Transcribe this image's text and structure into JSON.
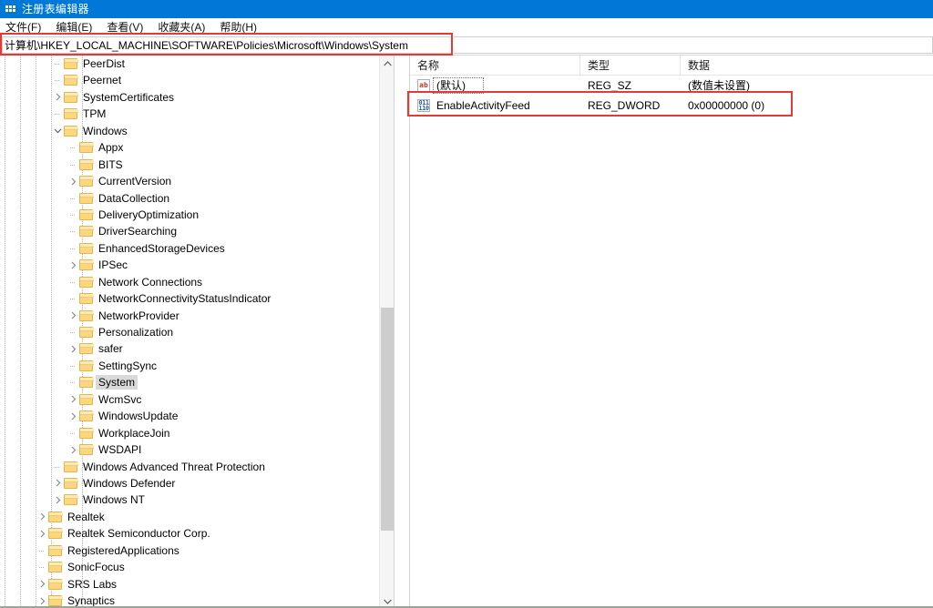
{
  "window": {
    "title": "注册表编辑器",
    "icon": "registry-icon"
  },
  "menubar": {
    "items": [
      {
        "label": "文件(F)",
        "name": "menu-file"
      },
      {
        "label": "编辑(E)",
        "name": "menu-edit"
      },
      {
        "label": "查看(V)",
        "name": "menu-view"
      },
      {
        "label": "收藏夹(A)",
        "name": "menu-favorites"
      },
      {
        "label": "帮助(H)",
        "name": "menu-help"
      }
    ]
  },
  "address_bar": {
    "value": "计算机\\HKEY_LOCAL_MACHINE\\SOFTWARE\\Policies\\Microsoft\\Windows\\System",
    "highlight_color": "#e23b33"
  },
  "tree": {
    "scrollbar": {
      "up_arrow": "▲",
      "down_arrow": "▼"
    },
    "nodes": [
      {
        "label": "PeerDist",
        "depth": 4,
        "expander": "leaf",
        "selected": false
      },
      {
        "label": "Peernet",
        "depth": 4,
        "expander": "leaf",
        "selected": false
      },
      {
        "label": "SystemCertificates",
        "depth": 4,
        "expander": "collapsed",
        "selected": false
      },
      {
        "label": "TPM",
        "depth": 4,
        "expander": "leaf",
        "selected": false
      },
      {
        "label": "Windows",
        "depth": 4,
        "expander": "expanded",
        "selected": false
      },
      {
        "label": "Appx",
        "depth": 5,
        "expander": "leaf",
        "selected": false
      },
      {
        "label": "BITS",
        "depth": 5,
        "expander": "leaf",
        "selected": false
      },
      {
        "label": "CurrentVersion",
        "depth": 5,
        "expander": "collapsed",
        "selected": false
      },
      {
        "label": "DataCollection",
        "depth": 5,
        "expander": "leaf",
        "selected": false
      },
      {
        "label": "DeliveryOptimization",
        "depth": 5,
        "expander": "leaf",
        "selected": false
      },
      {
        "label": "DriverSearching",
        "depth": 5,
        "expander": "leaf",
        "selected": false
      },
      {
        "label": "EnhancedStorageDevices",
        "depth": 5,
        "expander": "leaf",
        "selected": false
      },
      {
        "label": "IPSec",
        "depth": 5,
        "expander": "collapsed",
        "selected": false
      },
      {
        "label": "Network Connections",
        "depth": 5,
        "expander": "leaf",
        "selected": false
      },
      {
        "label": "NetworkConnectivityStatusIndicator",
        "depth": 5,
        "expander": "leaf",
        "selected": false
      },
      {
        "label": "NetworkProvider",
        "depth": 5,
        "expander": "collapsed",
        "selected": false
      },
      {
        "label": "Personalization",
        "depth": 5,
        "expander": "leaf",
        "selected": false
      },
      {
        "label": "safer",
        "depth": 5,
        "expander": "collapsed",
        "selected": false
      },
      {
        "label": "SettingSync",
        "depth": 5,
        "expander": "leaf",
        "selected": false
      },
      {
        "label": "System",
        "depth": 5,
        "expander": "leaf",
        "selected": true
      },
      {
        "label": "WcmSvc",
        "depth": 5,
        "expander": "collapsed",
        "selected": false
      },
      {
        "label": "WindowsUpdate",
        "depth": 5,
        "expander": "collapsed",
        "selected": false
      },
      {
        "label": "WorkplaceJoin",
        "depth": 5,
        "expander": "leaf",
        "selected": false
      },
      {
        "label": "WSDAPI",
        "depth": 5,
        "expander": "collapsed",
        "selected": false
      },
      {
        "label": "Windows Advanced Threat Protection",
        "depth": 4,
        "expander": "leaf",
        "selected": false
      },
      {
        "label": "Windows Defender",
        "depth": 4,
        "expander": "collapsed",
        "selected": false
      },
      {
        "label": "Windows NT",
        "depth": 4,
        "expander": "collapsed",
        "selected": false
      },
      {
        "label": "Realtek",
        "depth": 3,
        "expander": "collapsed",
        "selected": false
      },
      {
        "label": "Realtek Semiconductor Corp.",
        "depth": 3,
        "expander": "collapsed",
        "selected": false
      },
      {
        "label": "RegisteredApplications",
        "depth": 3,
        "expander": "leaf",
        "selected": false
      },
      {
        "label": "SonicFocus",
        "depth": 3,
        "expander": "leaf",
        "selected": false
      },
      {
        "label": "SRS Labs",
        "depth": 3,
        "expander": "collapsed",
        "selected": false
      },
      {
        "label": "Synaptics",
        "depth": 3,
        "expander": "collapsed",
        "selected": false
      }
    ]
  },
  "values_list": {
    "columns": [
      {
        "label": "名称",
        "name": "column-name"
      },
      {
        "label": "类型",
        "name": "column-type"
      },
      {
        "label": "数据",
        "name": "column-data"
      }
    ],
    "rows": [
      {
        "name": "(默认)",
        "type": "REG_SZ",
        "data": "(数值未设置)",
        "icon": "string-value-icon",
        "icon_text": "ab",
        "highlighted": false
      },
      {
        "name": "EnableActivityFeed",
        "type": "REG_DWORD",
        "data": "0x00000000 (0)",
        "icon": "dword-value-icon",
        "icon_top": "011",
        "icon_bottom": "110",
        "highlighted": true
      }
    ],
    "highlight_color": "#e23b33"
  }
}
